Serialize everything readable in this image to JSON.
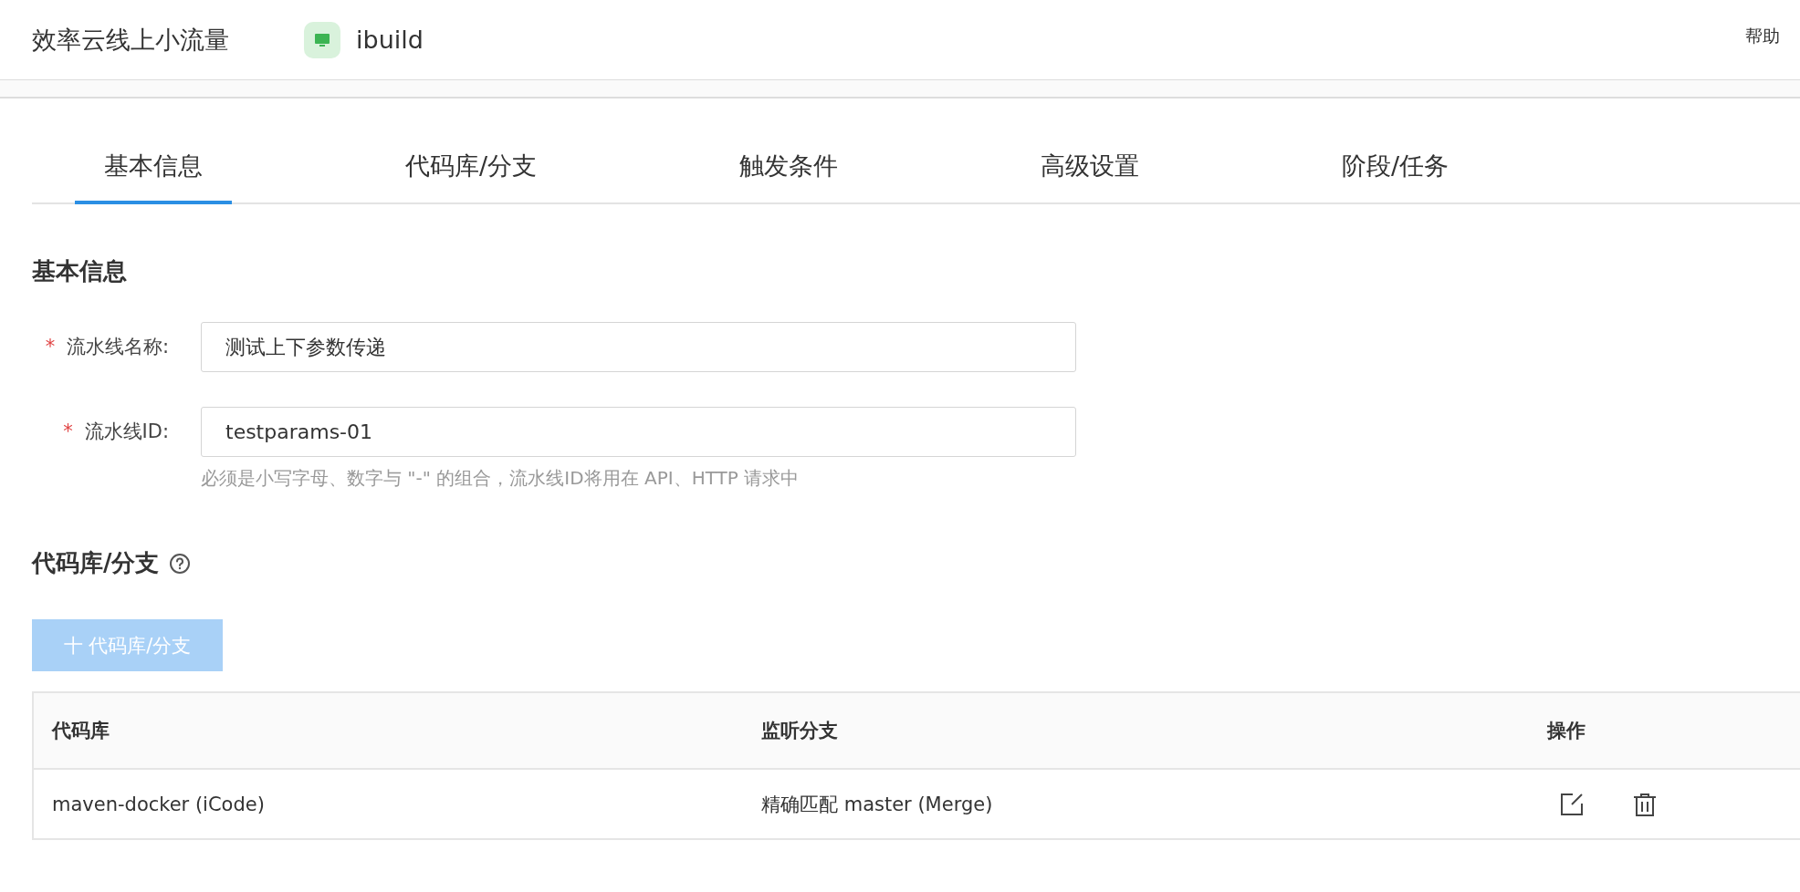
{
  "header": {
    "title": "效率云线上小流量",
    "app_name": "ibuild",
    "help": "帮助"
  },
  "tabs": [
    {
      "label": "基本信息",
      "selected": true
    },
    {
      "label": "代码库/分支",
      "selected": false
    },
    {
      "label": "触发条件",
      "selected": false
    },
    {
      "label": "高级设置",
      "selected": false
    },
    {
      "label": "阶段/任务",
      "selected": false
    }
  ],
  "basic_section": {
    "title": "基本信息",
    "fields": [
      {
        "label": "流水线名称:",
        "required_mark": "*",
        "value": "测试上下参数传递"
      },
      {
        "label": "流水线ID:",
        "required_mark": "*",
        "value": "testparams-01",
        "hint": "必须是小写字母、数字与 \"-\" 的组合，流水线ID将用在 API、HTTP 请求中"
      }
    ]
  },
  "repo_section": {
    "title": "代码库/分支",
    "add_button": {
      "label": "十 代码库/分支",
      "disabled": true
    },
    "table": {
      "columns": [
        "代码库",
        "监听分支",
        "操作"
      ],
      "rows": [
        {
          "repo": "maven-docker (iCode)",
          "branch": "精确匹配 master (Merge)"
        }
      ]
    }
  }
}
